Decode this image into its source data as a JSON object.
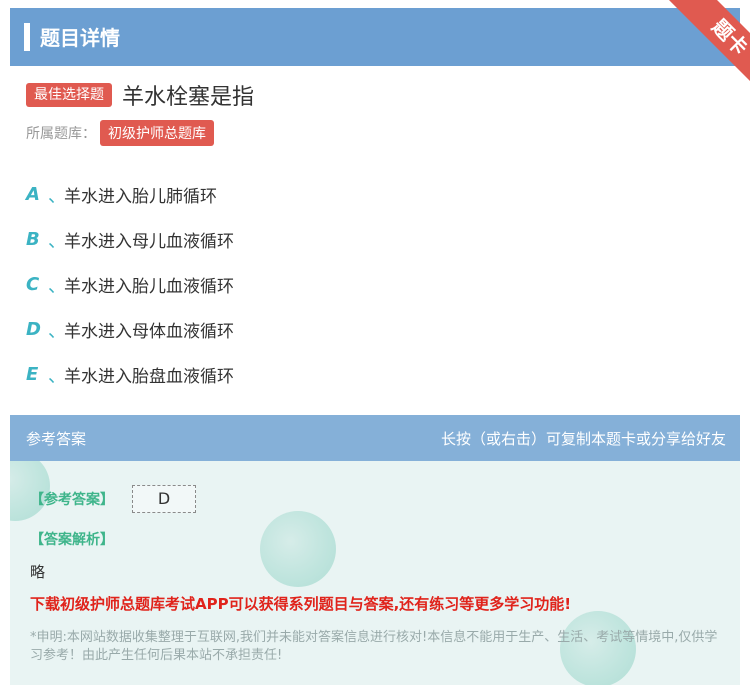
{
  "header": {
    "title": "题目详情",
    "ribbon": "题卡"
  },
  "question": {
    "type_tag": "最佳选择题",
    "title": "羊水栓塞是指",
    "bank_label": "所属题库：",
    "bank_name": "初级护师总题库"
  },
  "options": [
    {
      "letter": "A",
      "sep": "、",
      "text": "羊水进入胎儿肺循环"
    },
    {
      "letter": "B",
      "sep": "、",
      "text": "羊水进入母儿血液循环"
    },
    {
      "letter": "C",
      "sep": "、",
      "text": "羊水进入胎儿血液循环"
    },
    {
      "letter": "D",
      "sep": "、",
      "text": "羊水进入母体血液循环"
    },
    {
      "letter": "E",
      "sep": "、",
      "text": "羊水进入胎盘血液循环"
    }
  ],
  "answer_section": {
    "bar_left": "参考答案",
    "bar_right": "长按（或右击）可复制本题卡或分享给好友",
    "answer_label": "【参考答案】",
    "answer_value": "D",
    "analysis_label": "【答案解析】",
    "analysis_text": "略",
    "promo": "下载初级护师总题库考试APP可以获得系列题目与答案,还有练习等更多学习功能!",
    "disclaimer": "*申明:本网站数据收集整理于互联网,我们并未能对答案信息进行核对!本信息不能用于生产、生活、考试等情境中,仅供学习参考！由此产生任何后果本站不承担责任!"
  },
  "colors": {
    "header_bg": "#6c9fd2",
    "tag_red": "#e05a50",
    "option_letter": "#3bb3c3",
    "answer_label": "#3fb58b",
    "promo": "#e0231b"
  }
}
